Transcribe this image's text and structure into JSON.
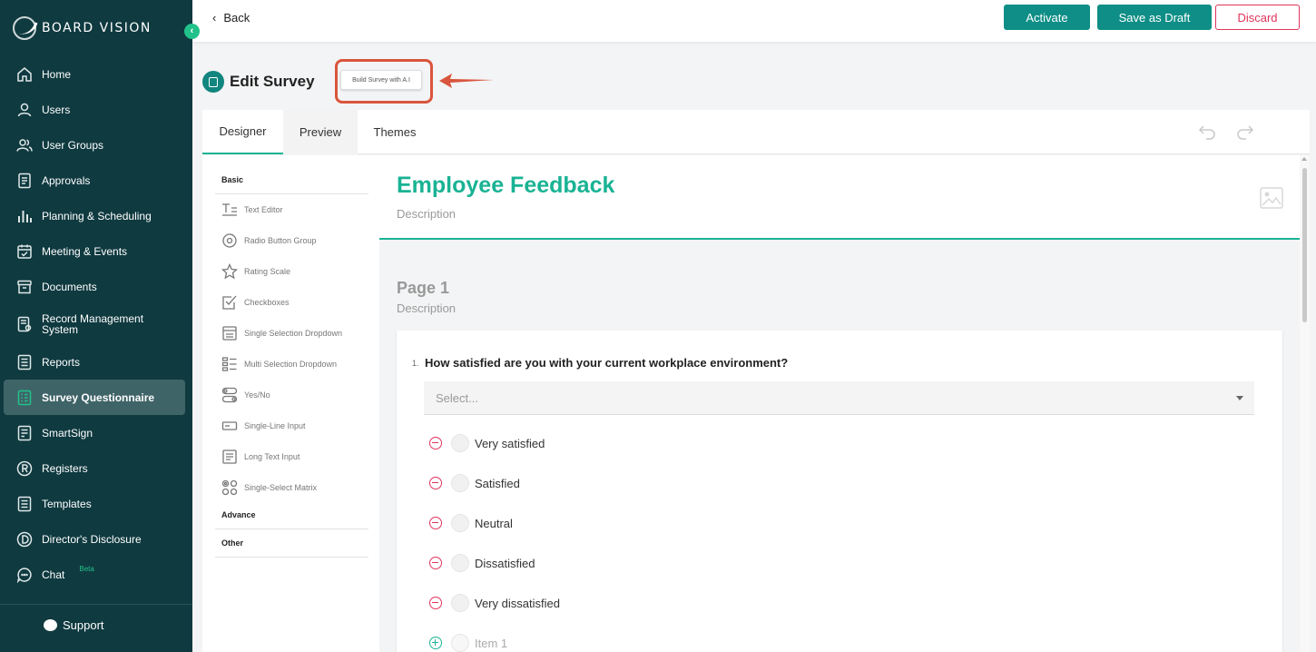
{
  "brand": {
    "name": "BOARD VISION"
  },
  "sidebar": {
    "items": [
      {
        "label": "Home",
        "icon": "home-icon"
      },
      {
        "label": "Users",
        "icon": "user-icon"
      },
      {
        "label": "User Groups",
        "icon": "users-icon"
      },
      {
        "label": "Approvals",
        "icon": "approvals-icon"
      },
      {
        "label": "Planning & Scheduling",
        "icon": "bar-chart-icon"
      },
      {
        "label": "Meeting & Events",
        "icon": "calendar-check-icon"
      },
      {
        "label": "Documents",
        "icon": "archive-icon"
      },
      {
        "label": "Record Management System",
        "icon": "record-icon"
      },
      {
        "label": "Reports",
        "icon": "report-icon"
      },
      {
        "label": "Survey Questionnaire",
        "icon": "survey-icon",
        "active": true
      },
      {
        "label": "SmartSign",
        "icon": "smartsign-icon"
      },
      {
        "label": "Registers",
        "icon": "registers-icon"
      },
      {
        "label": "Templates",
        "icon": "templates-icon"
      },
      {
        "label": "Director's Disclosure",
        "icon": "disclosure-icon"
      },
      {
        "label": "Chat",
        "icon": "chat-icon",
        "badge": "Beta"
      }
    ],
    "support": "Support"
  },
  "topbar": {
    "back": "Back",
    "activate": "Activate",
    "save_draft": "Save as Draft",
    "discard": "Discard"
  },
  "header": {
    "title": "Edit Survey",
    "ai_button": "Build Survey with A.I"
  },
  "tabs": [
    "Designer",
    "Preview",
    "Themes"
  ],
  "toolbox": {
    "sections": {
      "basic": "Basic",
      "advance": "Advance",
      "other": "Other"
    },
    "items": [
      {
        "label": "Text Editor",
        "icon": "text-editor-icon"
      },
      {
        "label": "Radio Button Group",
        "icon": "radio-icon"
      },
      {
        "label": "Rating Scale",
        "icon": "star-icon"
      },
      {
        "label": "Checkboxes",
        "icon": "checkbox-icon"
      },
      {
        "label": "Single Selection Dropdown",
        "icon": "dropdown-icon"
      },
      {
        "label": "Multi Selection Dropdown",
        "icon": "multi-dropdown-icon"
      },
      {
        "label": "Yes/No",
        "icon": "toggle-icon"
      },
      {
        "label": "Single-Line Input",
        "icon": "single-line-icon"
      },
      {
        "label": "Long Text Input",
        "icon": "long-text-icon"
      },
      {
        "label": "Single-Select Matrix",
        "icon": "matrix-icon"
      }
    ]
  },
  "survey": {
    "title": "Employee Feedback",
    "description": "Description",
    "page": {
      "title": "Page 1",
      "description": "Description"
    },
    "question": {
      "number": "1.",
      "text": "How satisfied are you with your current workplace environment?",
      "placeholder": "Select...",
      "choices": [
        "Very satisfied",
        "Satisfied",
        "Neutral",
        "Dissatisfied",
        "Very dissatisfied"
      ],
      "new_item": "Item 1"
    }
  },
  "colors": {
    "sidebar": "#0f3a40",
    "accent": "#19b394",
    "primary_button": "#0e8e86",
    "danger": "#e0345b",
    "highlight": "#d9553d"
  }
}
